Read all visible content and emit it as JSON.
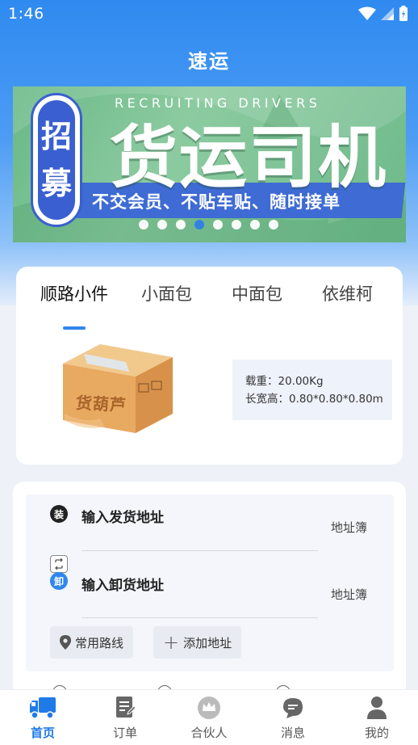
{
  "status_bar": {
    "time": "1:46"
  },
  "app_title": "速运",
  "banner": {
    "en_text": "RECRUITING DRIVERS",
    "main_text": "货运司机",
    "pill_text": [
      "招",
      "募"
    ],
    "sub_text": "不交会员、不贴车贴、随时接单",
    "dot_count": 8,
    "active_dot": 3
  },
  "vehicle_tabs": {
    "items": [
      {
        "label": "顺路小件",
        "active": true
      },
      {
        "label": "小面包",
        "active": false
      },
      {
        "label": "中面包",
        "active": false
      },
      {
        "label": "依维柯",
        "active": false
      }
    ]
  },
  "vehicle": {
    "box_brand": "货葫芦",
    "load_label": "载重：20.00Kg",
    "dimensions_label": "长宽高：0.80*0.80*0.80m"
  },
  "address": {
    "pickup": {
      "badge": "装",
      "label": "输入发货地址",
      "book": "地址簿"
    },
    "dropoff": {
      "badge": "卸",
      "label": "输入卸货地址",
      "book": "地址簿"
    },
    "common_routes": "常用路线",
    "add_address": "添加地址"
  },
  "bottom_nav": {
    "items": [
      {
        "label": "首页",
        "icon": "truck-icon",
        "active": true
      },
      {
        "label": "订单",
        "icon": "order-icon",
        "active": false
      },
      {
        "label": "合伙人",
        "icon": "crown-icon",
        "active": false
      },
      {
        "label": "消息",
        "icon": "message-icon",
        "active": false
      },
      {
        "label": "我的",
        "icon": "person-icon",
        "active": false
      }
    ]
  },
  "colors": {
    "primary": "#2f86ee",
    "banner_green": "#7cc394",
    "banner_blue": "#3a5fd0"
  }
}
